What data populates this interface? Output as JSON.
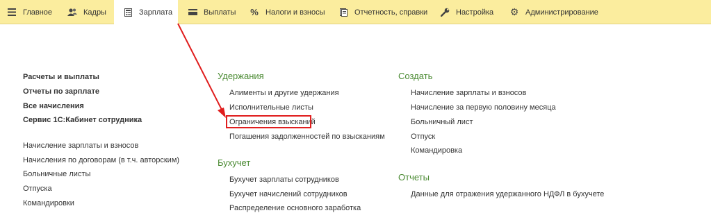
{
  "tabs": [
    {
      "label": "Главное",
      "icon": "menu-icon"
    },
    {
      "label": "Кадры",
      "icon": "people-icon"
    },
    {
      "label": "Зарплата",
      "icon": "calculator-icon",
      "active": true
    },
    {
      "label": "Выплаты",
      "icon": "card-icon"
    },
    {
      "label": "Налоги и взносы",
      "icon": "percent-icon"
    },
    {
      "label": "Отчетность, справки",
      "icon": "document-icon"
    },
    {
      "label": "Настройка",
      "icon": "wrench-icon"
    },
    {
      "label": "Администрирование",
      "icon": "gear-icon"
    }
  ],
  "left": {
    "bold_items": [
      "Расчеты и выплаты",
      "Отчеты по зарплате",
      "Все начисления",
      "Сервис 1С:Кабинет сотрудника"
    ],
    "items": [
      "Начисление зарплаты и взносов",
      "Начисления по договорам (в т.ч. авторским)",
      "Больничные листы",
      "Отпуска",
      "Командировки"
    ]
  },
  "deductions": {
    "title": "Удержания",
    "items": [
      "Алименты и другие удержания",
      "Исполнительные листы",
      "Ограничения взысканий",
      "Погашения задолженностей по взысканиям"
    ]
  },
  "accounting": {
    "title": "Бухучет",
    "items": [
      "Бухучет зарплаты сотрудников",
      "Бухучет начислений сотрудников",
      "Распределение основного заработка"
    ]
  },
  "create": {
    "title": "Создать",
    "items": [
      "Начисление зарплаты и взносов",
      "Начисление за первую половину месяца",
      "Больничный лист",
      "Отпуск",
      "Командировка"
    ]
  },
  "reports": {
    "title": "Отчеты",
    "items": [
      "Данные для отражения удержанного НДФЛ в бухучете"
    ]
  },
  "colors": {
    "topbar": "#fbed9e",
    "heading": "#4a8a32",
    "highlight": "#e01d1d"
  }
}
